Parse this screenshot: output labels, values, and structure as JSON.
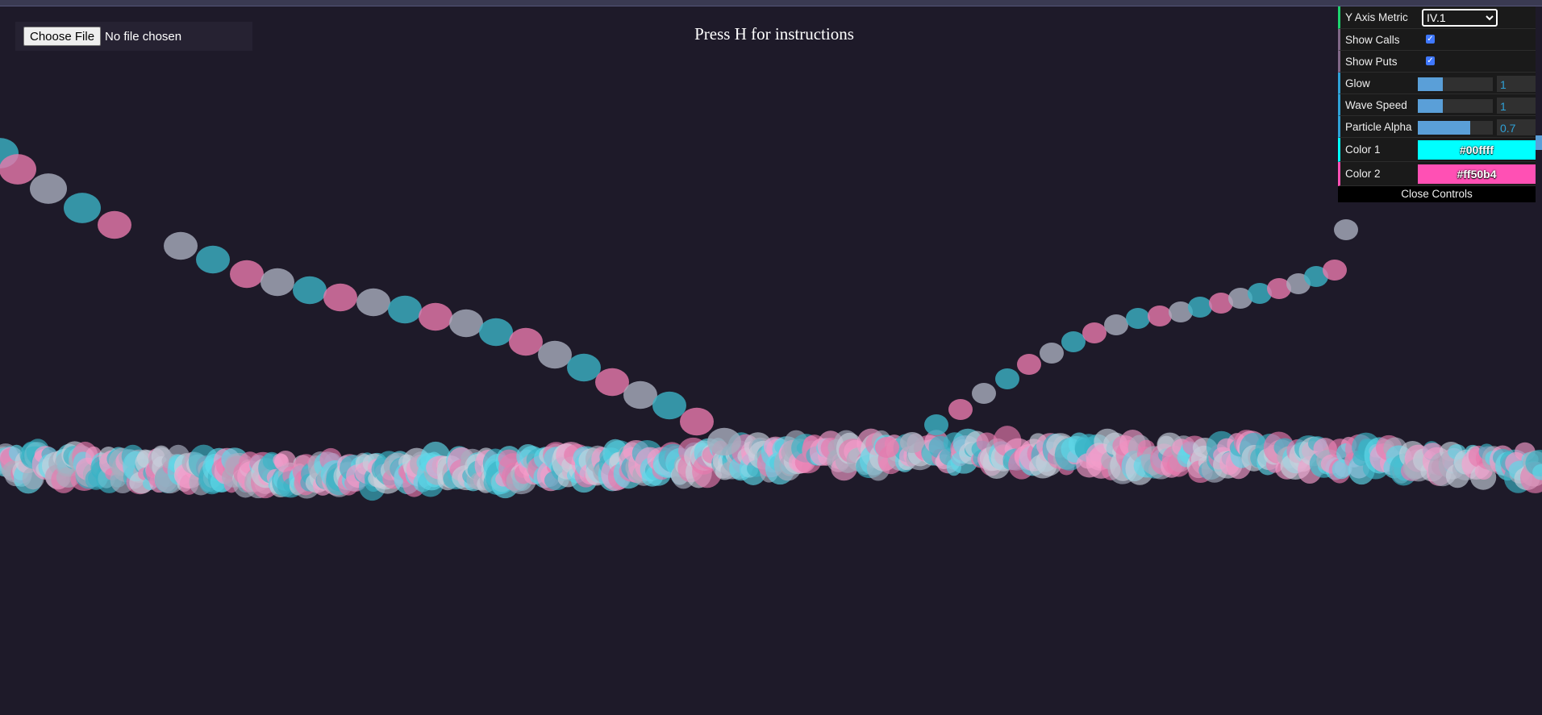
{
  "file_input": {
    "button_label": "Choose File",
    "status": "No file chosen"
  },
  "instructions": "Press H for instructions",
  "controls": {
    "y_axis_metric": {
      "label": "Y Axis Metric",
      "value": "IV.1",
      "options": [
        "IV.1"
      ]
    },
    "show_calls": {
      "label": "Show Calls",
      "checked": true
    },
    "show_puts": {
      "label": "Show Puts",
      "checked": true
    },
    "glow": {
      "label": "Glow",
      "value": "1",
      "fraction": 0.33
    },
    "wave_speed": {
      "label": "Wave Speed",
      "value": "1",
      "fraction": 0.33
    },
    "particle_alpha": {
      "label": "Particle Alpha",
      "value": "0.7",
      "fraction": 0.7
    },
    "color1": {
      "label": "Color 1",
      "value": "#00ffff"
    },
    "color2": {
      "label": "Color 2",
      "value": "#ff50b4"
    },
    "close_label": "Close Controls"
  },
  "colors": {
    "background": "#1e1a29",
    "color1": "#00ffff",
    "color2": "#ff50b4",
    "accent": "#2fa1d6"
  }
}
